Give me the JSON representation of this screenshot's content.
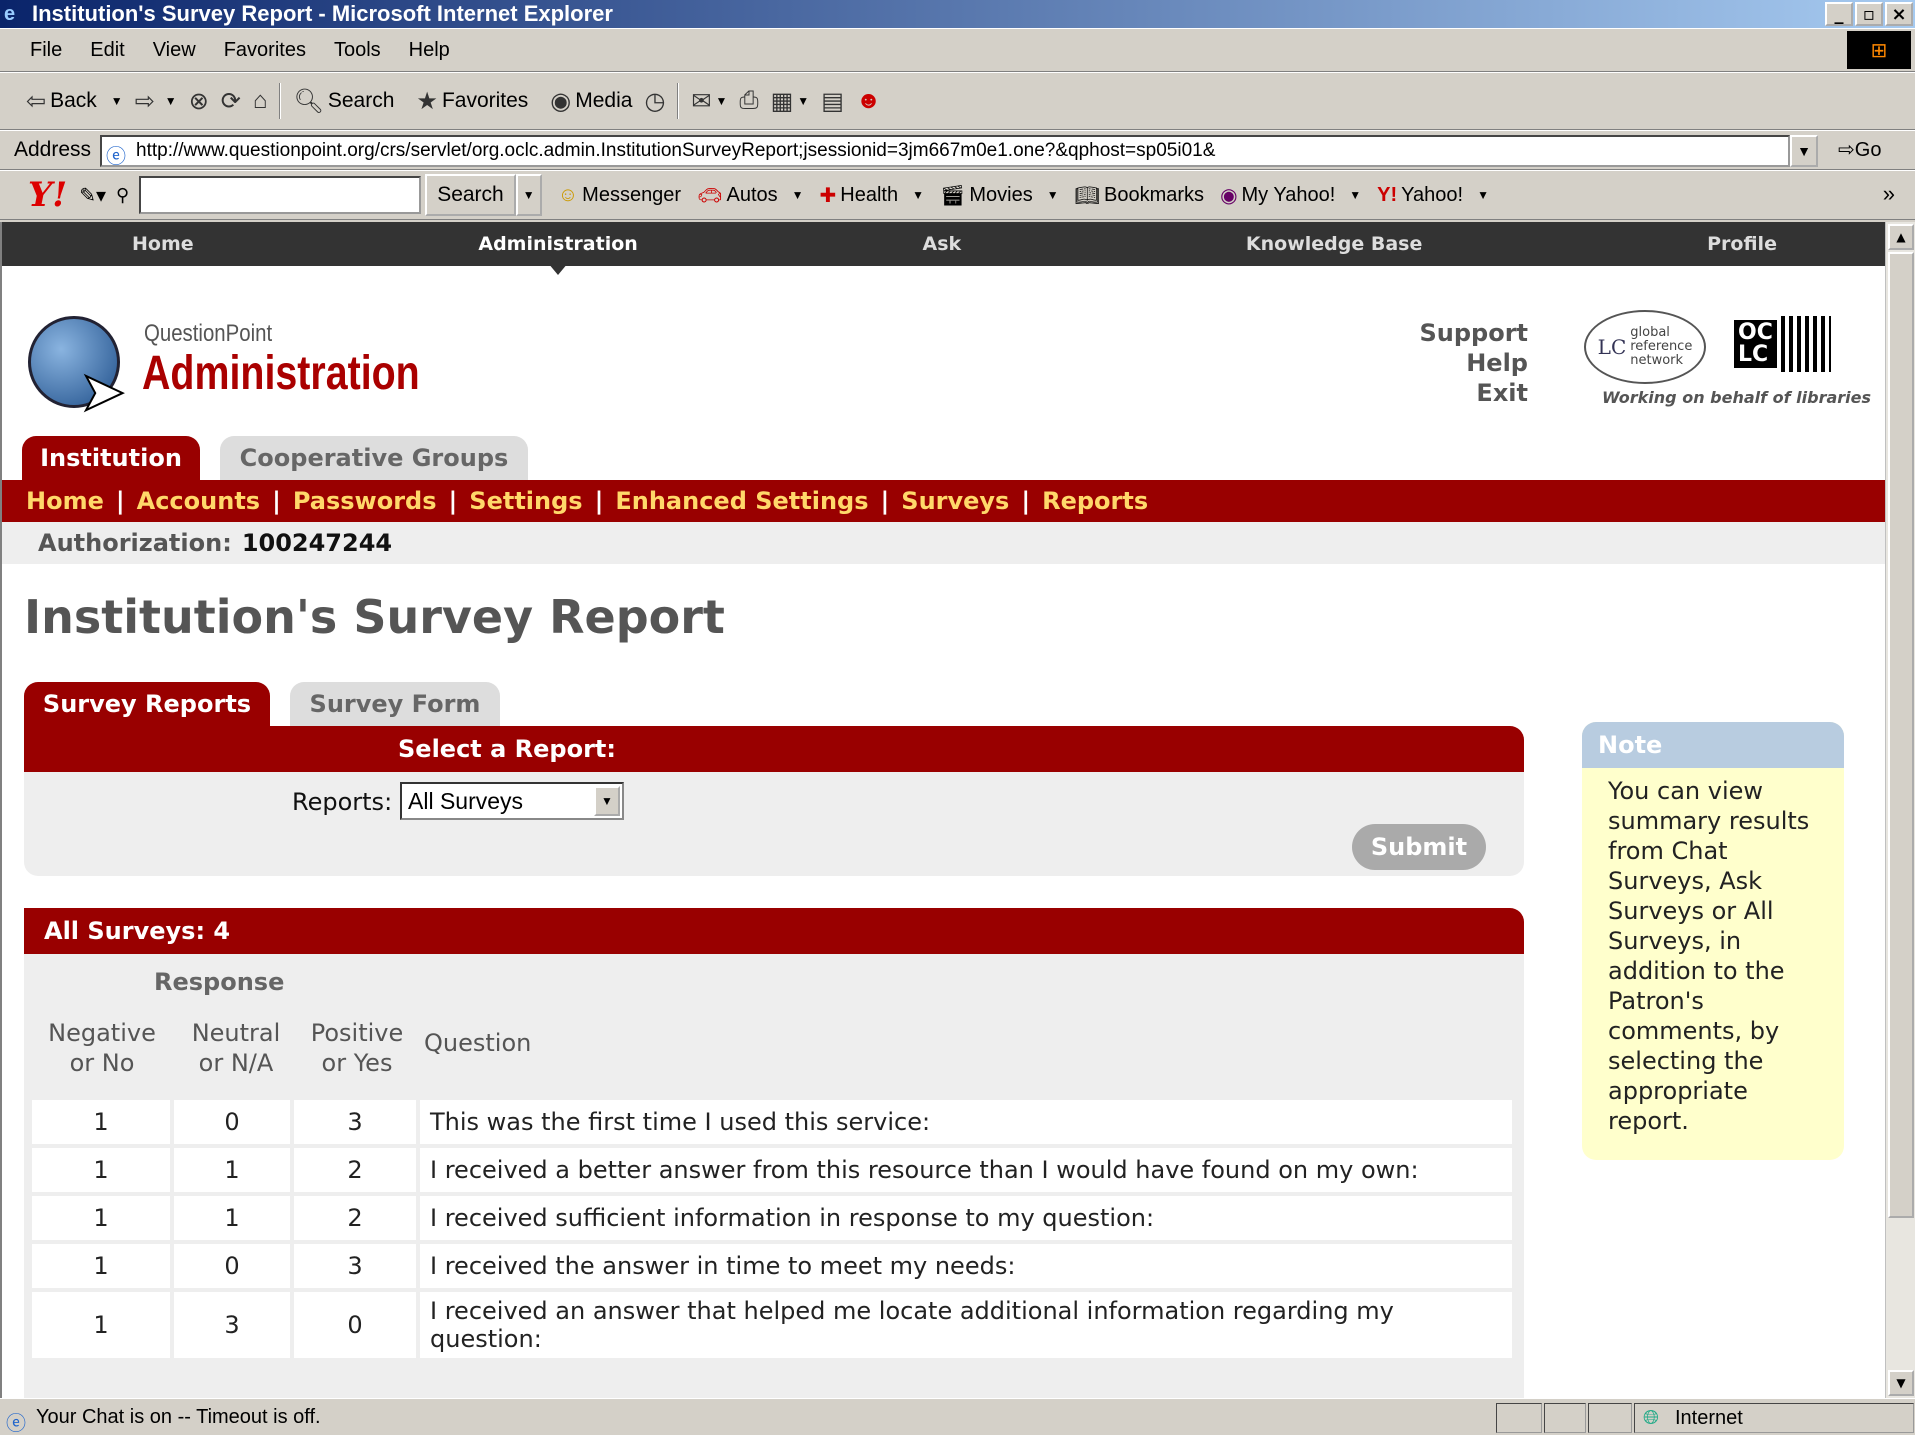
{
  "window": {
    "title": "Institution's Survey Report - Microsoft Internet Explorer",
    "min": "_",
    "max": "▫",
    "close": "×"
  },
  "menu": [
    "File",
    "Edit",
    "View",
    "Favorites",
    "Tools",
    "Help"
  ],
  "toolbar": {
    "back": "Back",
    "search": "Search",
    "favorites": "Favorites",
    "media": "Media"
  },
  "address": {
    "label": "Address",
    "url": "http://www.questionpoint.org/crs/servlet/org.oclc.admin.InstitutionSurveyReport;jsessionid=3jm667m0e1.one?&qphost=sp05i01&",
    "go": "Go"
  },
  "yahoo": {
    "search": "Search",
    "items": [
      "Messenger",
      "Autos",
      "Health",
      "Movies",
      "Bookmarks",
      "My Yahoo!",
      "Yahoo!"
    ],
    "more": "»"
  },
  "topnav": [
    "Home",
    "Administration",
    "Ask",
    "Knowledge Base",
    "Profile"
  ],
  "header": {
    "product": "QuestionPoint",
    "section": "Administration",
    "links": [
      "Support",
      "Help",
      "Exit"
    ],
    "lc_logo": "LC global reference network",
    "oclc": "OC LC",
    "tagline": "Working on behalf of libraries"
  },
  "tabs": {
    "institution": "Institution",
    "cooperative": "Cooperative Groups"
  },
  "subnav": [
    "Home",
    "Accounts",
    "Passwords",
    "Settings",
    "Enhanced Settings",
    "Surveys",
    "Reports"
  ],
  "auth": {
    "label": "Authorization:",
    "value": "100247244"
  },
  "page_title": "Institution's Survey Report",
  "report_tabs": {
    "reports": "Survey Reports",
    "form": "Survey Form"
  },
  "select": {
    "heading": "Select a Report:",
    "label": "Reports:",
    "value": "All Surveys",
    "submit": "Submit"
  },
  "results": {
    "heading": "All Surveys: 4",
    "response_label": "Response",
    "columns": [
      "Negative\nor No",
      "Neutral\nor N/A",
      "Positive\nor Yes",
      "Question"
    ],
    "rows": [
      {
        "neg": "1",
        "neu": "0",
        "pos": "3",
        "q": "This was the first time I used this service:"
      },
      {
        "neg": "1",
        "neu": "1",
        "pos": "2",
        "q": "I received a better answer from this resource than I would have found on my own:"
      },
      {
        "neg": "1",
        "neu": "1",
        "pos": "2",
        "q": "I received sufficient information in response to my question:"
      },
      {
        "neg": "1",
        "neu": "0",
        "pos": "3",
        "q": "I received the answer in time to meet my needs:"
      },
      {
        "neg": "1",
        "neu": "3",
        "pos": "0",
        "q": "I received an answer that helped me locate additional information regarding my question:"
      }
    ]
  },
  "note": {
    "heading": "Note",
    "text": "You can view summary results from Chat Surveys, Ask Surveys or All Surveys, in addition to the Patron's comments, by selecting the appropriate report."
  },
  "status": {
    "text": "Your Chat is on -- Timeout is off.",
    "zone": "Internet"
  }
}
